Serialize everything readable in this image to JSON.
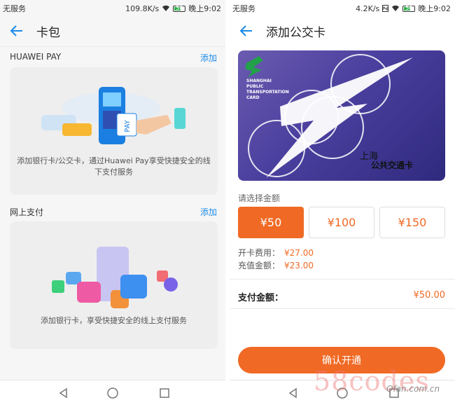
{
  "left": {
    "status": {
      "carrier": "无服务",
      "speed": "109.8K/s",
      "battery": "50",
      "time": "晚上9:02"
    },
    "title": "卡包",
    "huawei_pay": {
      "label": "HUAWEI PAY",
      "add": "添加",
      "card_text": "添加银行卡/公交卡，通过Huawei Pay享受快捷安全的线下支付服务"
    },
    "online": {
      "label": "网上支付",
      "add": "添加",
      "card_text": "添加银行卡，享受快捷安全的线上支付服务"
    }
  },
  "right": {
    "status": {
      "carrier": "无服务",
      "speed": "4.2K/s",
      "battery": "50",
      "time": "晚上9:02"
    },
    "title": "添加公交卡",
    "transit_card": {
      "en_line1": "SHANGHAI",
      "en_line2": "PUBLIC",
      "en_line3": "TRANSPORTATION",
      "en_line4": "CARD",
      "cn_city": "上海",
      "cn_name": "公共交通卡"
    },
    "amount_label": "请选择金额",
    "amounts": [
      "¥50",
      "¥100",
      "¥150"
    ],
    "selected_amount_index": 0,
    "fees": {
      "open_label": "开卡费用：",
      "open_value": "¥27.00",
      "recharge_label": "充值金额：",
      "recharge_value": "¥23.00"
    },
    "pay_label": "支付金额：",
    "pay_value": "¥50.00",
    "confirm": "确认开通"
  },
  "watermark": "58codes",
  "watermark_small": "Qfan.com.cn",
  "colors": {
    "accent": "#f06a25",
    "link": "#1a8be8",
    "card_purple": "#4a3f9e"
  }
}
